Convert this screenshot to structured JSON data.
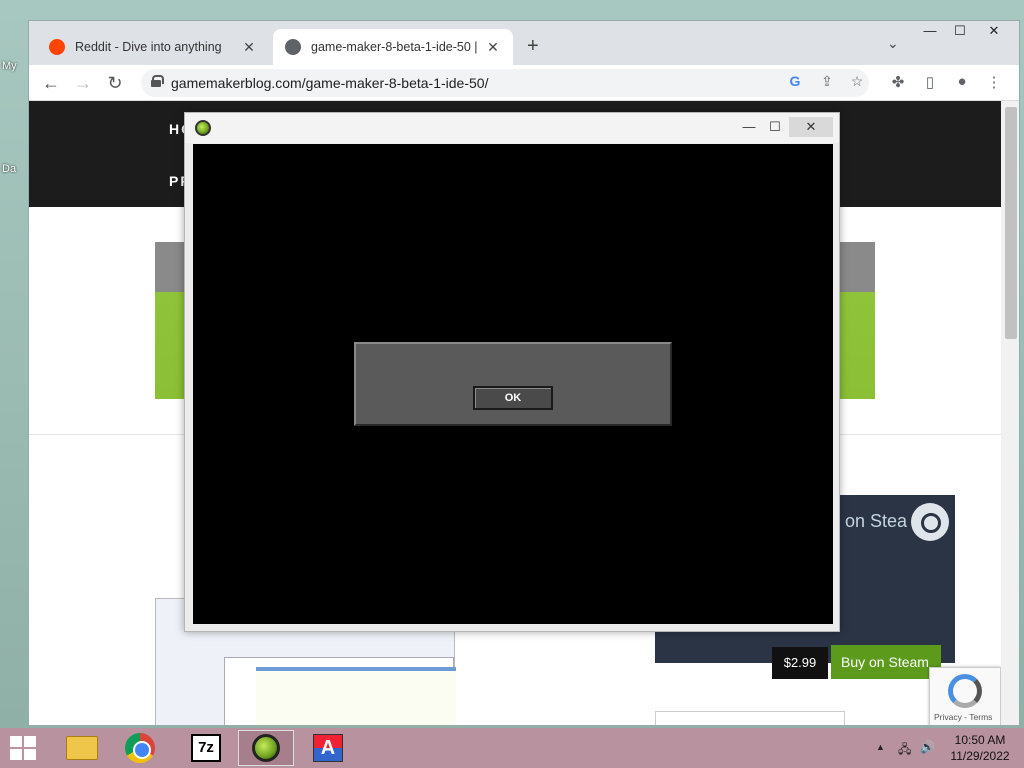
{
  "desktop": {
    "icon_labels": [
      "My",
      "Da"
    ]
  },
  "browser": {
    "tabs": [
      {
        "title": "Reddit - Dive into anything",
        "close": "✕"
      },
      {
        "title": "game-maker-8-beta-1-ide-50 |",
        "close": "✕"
      }
    ],
    "new_tab": "+",
    "tab_search": "⌄",
    "window_controls": {
      "minimize": "—",
      "maximize": "☐",
      "close": "✕"
    },
    "nav": {
      "back": "←",
      "forward": "→",
      "reload": "↻"
    },
    "url": "gamemakerblog.com/game-maker-8-beta-1-ide-50/"
  },
  "page": {
    "nav_items": [
      "HO",
      "PR"
    ],
    "steam_text": "on Stea",
    "price": "$2.99",
    "buy_label": "Buy on Steam",
    "recaptcha_links": "Privacy - Terms"
  },
  "game_window": {
    "controls": {
      "minimize": "—",
      "maximize": "☐",
      "close": "✕"
    },
    "dialog": {
      "ok_label": "OK"
    }
  },
  "taskbar": {
    "time": "10:50 AM",
    "date": "11/29/2022",
    "tray": {
      "show_hidden": "▲",
      "network": "🖧",
      "volume": "🔊"
    },
    "apps": {
      "sevenzip": "7z",
      "a_app": "A"
    }
  }
}
